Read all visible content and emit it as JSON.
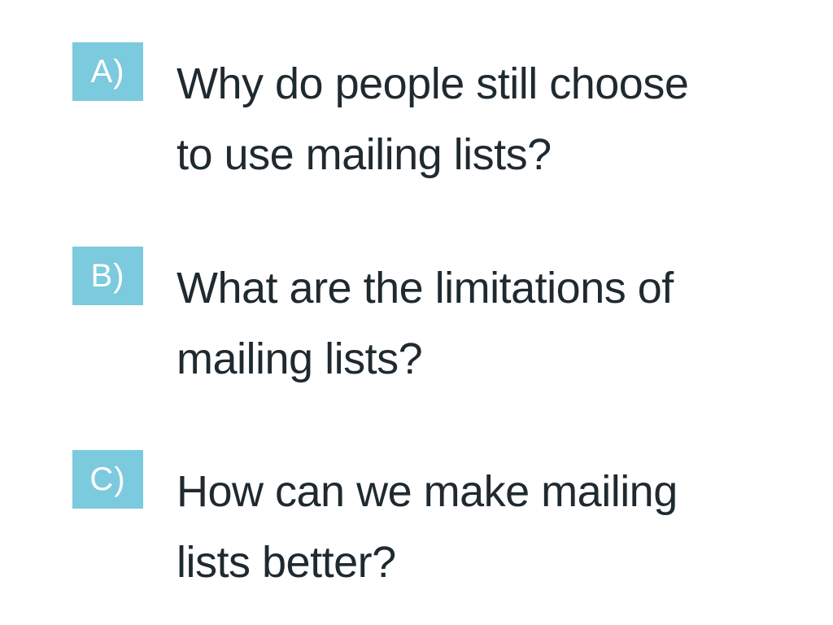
{
  "questions": [
    {
      "label": "A)",
      "text_line1": "Why do people still choose",
      "text_line2": "to use mailing lists?"
    },
    {
      "label": "B)",
      "text_line1": "What are the limitations of",
      "text_line2": "mailing lists?"
    },
    {
      "label": "C)",
      "text_line1": "How can we make mailing",
      "text_line2": "lists better?"
    }
  ],
  "colors": {
    "badge_background": "#7ccadd",
    "badge_text": "#ffffff",
    "body_text": "#1f2a30",
    "background": "#ffffff"
  }
}
